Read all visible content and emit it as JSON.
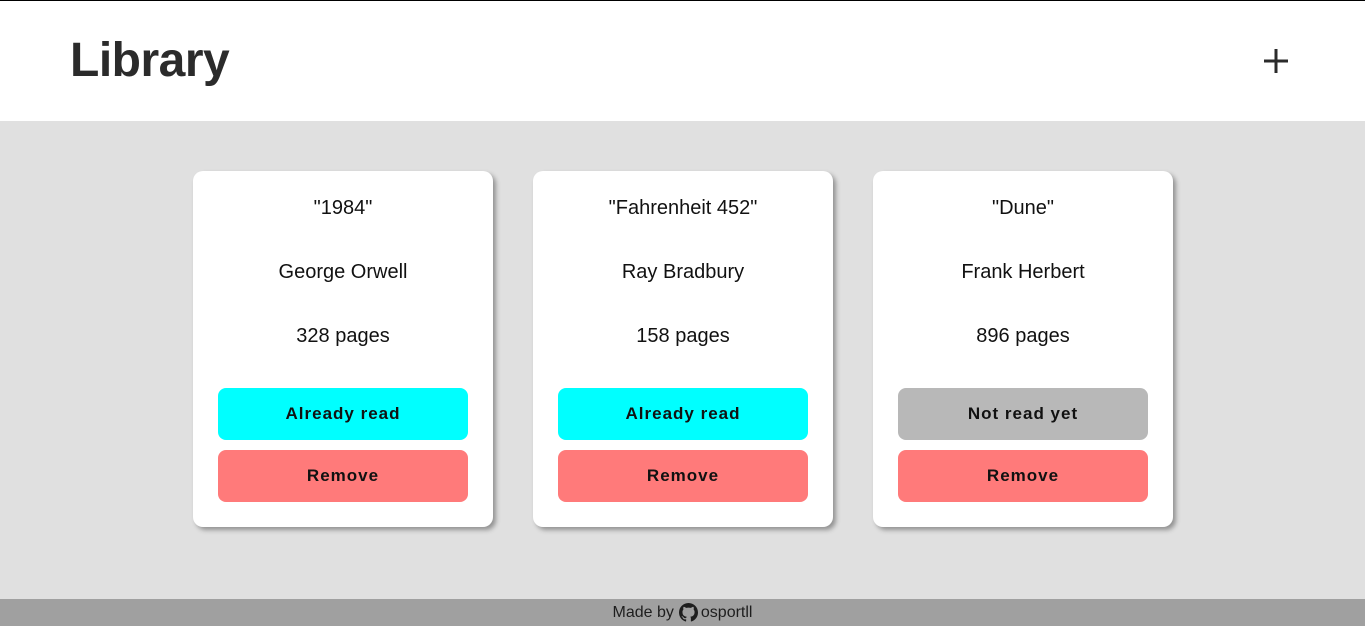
{
  "header": {
    "title": "Library",
    "add_icon": "plus-icon"
  },
  "books": [
    {
      "title": "\"1984\"",
      "author": "George Orwell",
      "pages": "328 pages",
      "status": "Already read",
      "read": true,
      "remove_label": "Remove"
    },
    {
      "title": "\"Fahrenheit 452\"",
      "author": "Ray Bradbury",
      "pages": "158 pages",
      "status": "Already read",
      "read": true,
      "remove_label": "Remove"
    },
    {
      "title": "\"Dune\"",
      "author": "Frank Herbert",
      "pages": "896 pages",
      "status": "Not read yet",
      "read": false,
      "remove_label": "Remove"
    }
  ],
  "footer": {
    "made_by": "Made by",
    "author": "osportll",
    "icon": "github-icon"
  },
  "colors": {
    "read": "#00ffff",
    "not_read": "#b8b8b8",
    "remove": "#ff7a7a",
    "background": "#e0e0e0",
    "footer": "#a0a0a0"
  }
}
